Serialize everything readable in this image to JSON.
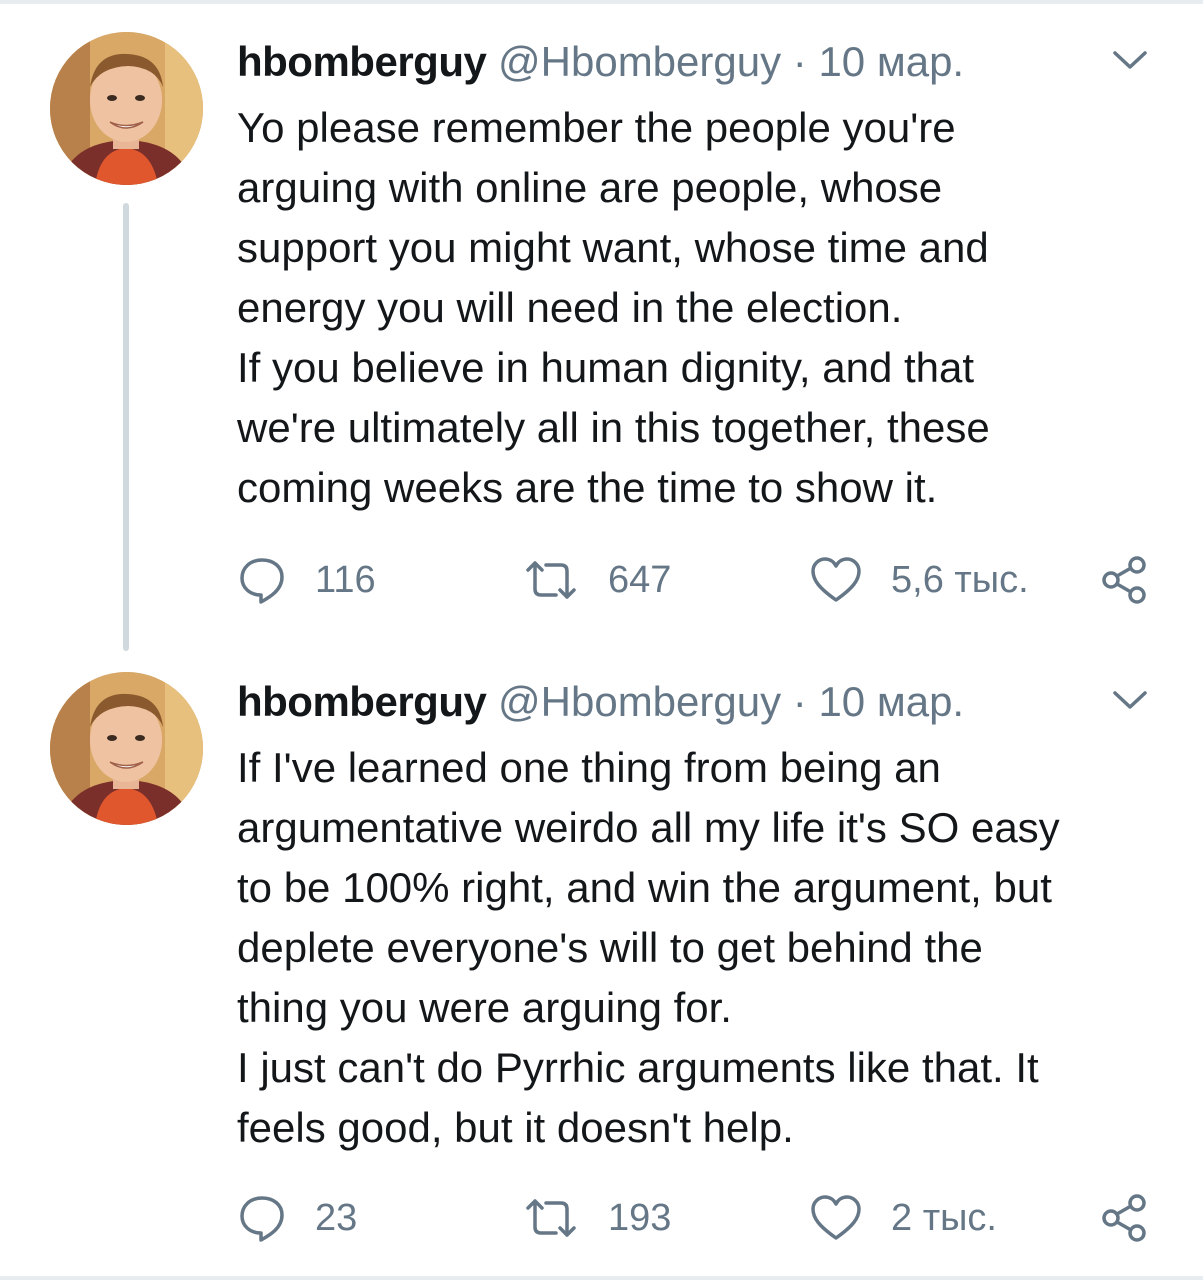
{
  "tweets": [
    {
      "author_name": "hbomberguy",
      "author_handle": "@Hbomberguy",
      "separator": "·",
      "date": "10 мар.",
      "paragraphs": [
        "Yo please remember the people you're\narguing with online are people, whose\nsupport you might want, whose time and\nenergy you will need in the election.",
        "If you believe in human dignity, and that\nwe're ultimately all in this together, these\ncoming weeks are the time to show it."
      ],
      "replies": "116",
      "retweets": "647",
      "likes": "5,6 тыс."
    },
    {
      "author_name": "hbomberguy",
      "author_handle": "@Hbomberguy",
      "separator": "·",
      "date": "10 мар.",
      "paragraphs": [
        "If I've learned one thing from being an\nargumentative weirdo all my life it's SO easy\nto be 100% right, and win the argument, but\ndeplete everyone's will to get behind the\nthing you were arguing for.",
        "I just can't do Pyrrhic arguments like that. It\nfeels good, but it doesn't help."
      ],
      "replies": "23",
      "retweets": "193",
      "likes": "2 тыс."
    }
  ],
  "icons": {
    "reply": "speech-bubble-icon",
    "retweet": "retweet-arrows-icon",
    "like": "heart-icon",
    "share": "share-nodes-icon",
    "menu": "chevron-down-icon"
  },
  "colors": {
    "text": "#14171a",
    "secondary": "#657786",
    "thread_line": "#cfd9de",
    "divider": "#e6ecf0"
  }
}
